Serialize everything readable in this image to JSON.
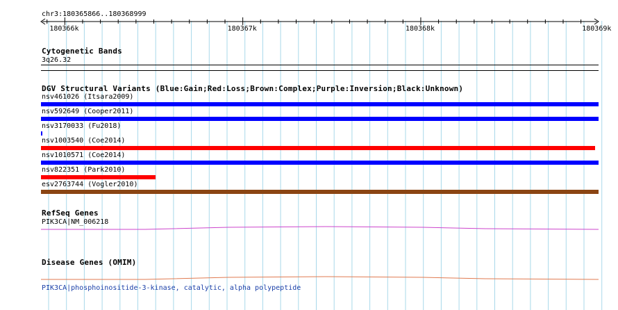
{
  "ruler": {
    "location": "chr3:180365866..180368999",
    "ticks": [
      {
        "pos": 180366000,
        "label": "180366k"
      },
      {
        "pos": 180367000,
        "label": "180367k"
      },
      {
        "pos": 180368000,
        "label": "180368k"
      },
      {
        "pos": 180369000,
        "label": "180369k"
      }
    ],
    "view_start": 180365866,
    "view_end": 180368999
  },
  "cytoband": {
    "title": "Cytogenetic Bands",
    "band": "3q26.32"
  },
  "dgv": {
    "title": "DGV Structural Variants (Blue:Gain;Red:Loss;Brown:Complex;Purple:Inversion;Black:Unknown)",
    "colors": {
      "gain": "#0000ff",
      "loss": "#ff0000",
      "complex": "#8b4513"
    },
    "variants": [
      {
        "label": "nsv461026 (Itsara2009)",
        "type": "gain",
        "start": 180365866,
        "end": 180368999
      },
      {
        "label": "nsv592649 (Cooper2011)",
        "type": "gain",
        "start": 180365866,
        "end": 180368999
      },
      {
        "label": "nsv3170033 (Fu2018)",
        "type": "gain",
        "start": 180365866,
        "end": 180365875
      },
      {
        "label": "nsv1003540 (Coe2014)",
        "type": "loss",
        "start": 180365866,
        "end": 180368980
      },
      {
        "label": "nsv1010571 (Coe2014)",
        "type": "gain",
        "start": 180365866,
        "end": 180368999
      },
      {
        "label": "nsv822351 (Park2010)",
        "type": "loss",
        "start": 180365866,
        "end": 180366510
      },
      {
        "label": "esv2763744 (Vogler2010)",
        "type": "complex",
        "start": 180365866,
        "end": 180368999
      }
    ]
  },
  "refseq": {
    "title": "RefSeq Genes",
    "gene": "PIK3CA|NM_006218",
    "color": "#cc44cc"
  },
  "omim": {
    "title": "Disease Genes (OMIM)",
    "gene": "PIK3CA|phosphoinositide-3-kinase, catalytic, alpha polypeptide",
    "color": "#e07a50",
    "label_color": "#1a3fa8"
  },
  "grid_color": "#a8d8ea"
}
